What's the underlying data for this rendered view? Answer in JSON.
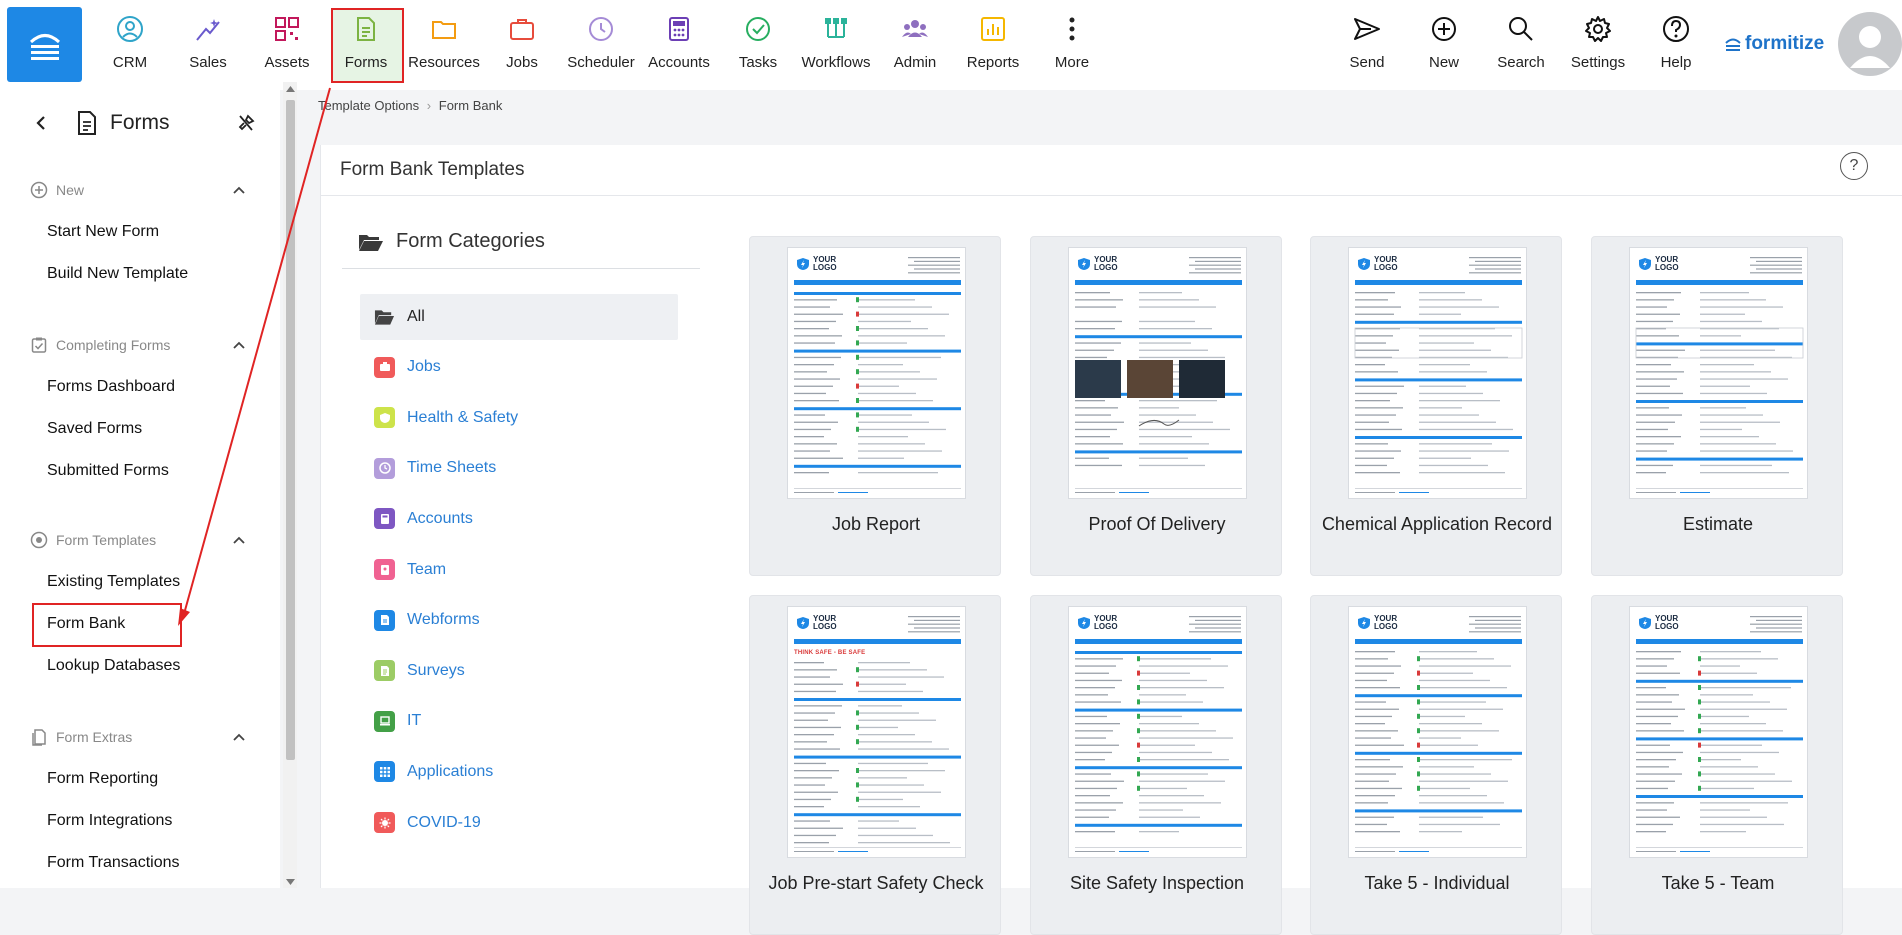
{
  "nav": {
    "items": [
      {
        "label": "CRM",
        "icon": "crm-icon"
      },
      {
        "label": "Sales",
        "icon": "sales-icon"
      },
      {
        "label": "Assets",
        "icon": "assets-icon"
      },
      {
        "label": "Forms",
        "icon": "forms-icon"
      },
      {
        "label": "Resources",
        "icon": "resources-icon"
      },
      {
        "label": "Jobs",
        "icon": "jobs-icon"
      },
      {
        "label": "Scheduler",
        "icon": "scheduler-icon"
      },
      {
        "label": "Accounts",
        "icon": "accounts-icon"
      },
      {
        "label": "Tasks",
        "icon": "tasks-icon"
      },
      {
        "label": "Workflows",
        "icon": "workflows-icon"
      },
      {
        "label": "Admin",
        "icon": "admin-icon"
      },
      {
        "label": "Reports",
        "icon": "reports-icon"
      },
      {
        "label": "More",
        "icon": "more-icon"
      }
    ],
    "right": [
      {
        "label": "Send",
        "icon": "send-icon"
      },
      {
        "label": "New",
        "icon": "plus-icon"
      },
      {
        "label": "Search",
        "icon": "search-icon"
      },
      {
        "label": "Settings",
        "icon": "gear-icon"
      },
      {
        "label": "Help",
        "icon": "help-icon"
      }
    ],
    "brand": "formitize",
    "active": "Forms",
    "accent": "#1e88e5",
    "highlight": "#e02424"
  },
  "sidebar": {
    "title": "Forms",
    "sections": [
      {
        "title": "New",
        "links": [
          "Start New Form",
          "Build New Template"
        ]
      },
      {
        "title": "Completing Forms",
        "links": [
          "Forms Dashboard",
          "Saved Forms",
          "Submitted Forms"
        ]
      },
      {
        "title": "Form Templates",
        "links": [
          "Existing Templates",
          "Form Bank",
          "Lookup Databases"
        ]
      },
      {
        "title": "Form Extras",
        "links": [
          "Form Reporting",
          "Form Integrations",
          "Form Transactions"
        ]
      }
    ],
    "highlighted_link": "Form Bank"
  },
  "breadcrumb": {
    "parent": "Template Options",
    "sep": "›",
    "current": "Form Bank"
  },
  "main": {
    "title": "Form Bank Templates",
    "help": "?",
    "categories_title": "Form Categories",
    "categories": [
      {
        "label": "All",
        "color": "#555555",
        "icon": "folder-open-icon"
      },
      {
        "label": "Jobs",
        "color": "#f05a5a",
        "icon": "briefcase-icon"
      },
      {
        "label": "Health & Safety",
        "color": "#cde34a",
        "icon": "shield-icon"
      },
      {
        "label": "Time Sheets",
        "color": "#b39ddb",
        "icon": "clock-icon"
      },
      {
        "label": "Accounts",
        "color": "#7e57c2",
        "icon": "calculator-icon"
      },
      {
        "label": "Team",
        "color": "#f06292",
        "icon": "badge-icon"
      },
      {
        "label": "Webforms",
        "color": "#1e88e5",
        "icon": "webform-icon"
      },
      {
        "label": "Surveys",
        "color": "#9ccc65",
        "icon": "survey-icon"
      },
      {
        "label": "IT",
        "color": "#43a047",
        "icon": "laptop-icon"
      },
      {
        "label": "Applications",
        "color": "#1e88e5",
        "icon": "grid-icon"
      },
      {
        "label": "COVID-19",
        "color": "#f05a5a",
        "icon": "virus-icon"
      }
    ],
    "templates": [
      {
        "name": "Job Report",
        "logo": "YOUR LOGO"
      },
      {
        "name": "Proof Of Delivery",
        "logo": "YOUR LOGO"
      },
      {
        "name": "Chemical Application Record",
        "logo": "YOUR LOGO"
      },
      {
        "name": "Estimate",
        "logo": "YOUR LOGO"
      },
      {
        "name": "Job Pre-start Safety Check",
        "logo": "YOUR LOGO",
        "doc_heading": "THINK SAFE - BE SAFE"
      },
      {
        "name": "Site Safety Inspection",
        "logo": "YOUR LOGO"
      },
      {
        "name": "Take 5 - Individual",
        "logo": "YOUR LOGO"
      },
      {
        "name": "Take 5 - Team",
        "logo": "YOUR LOGO"
      }
    ]
  }
}
